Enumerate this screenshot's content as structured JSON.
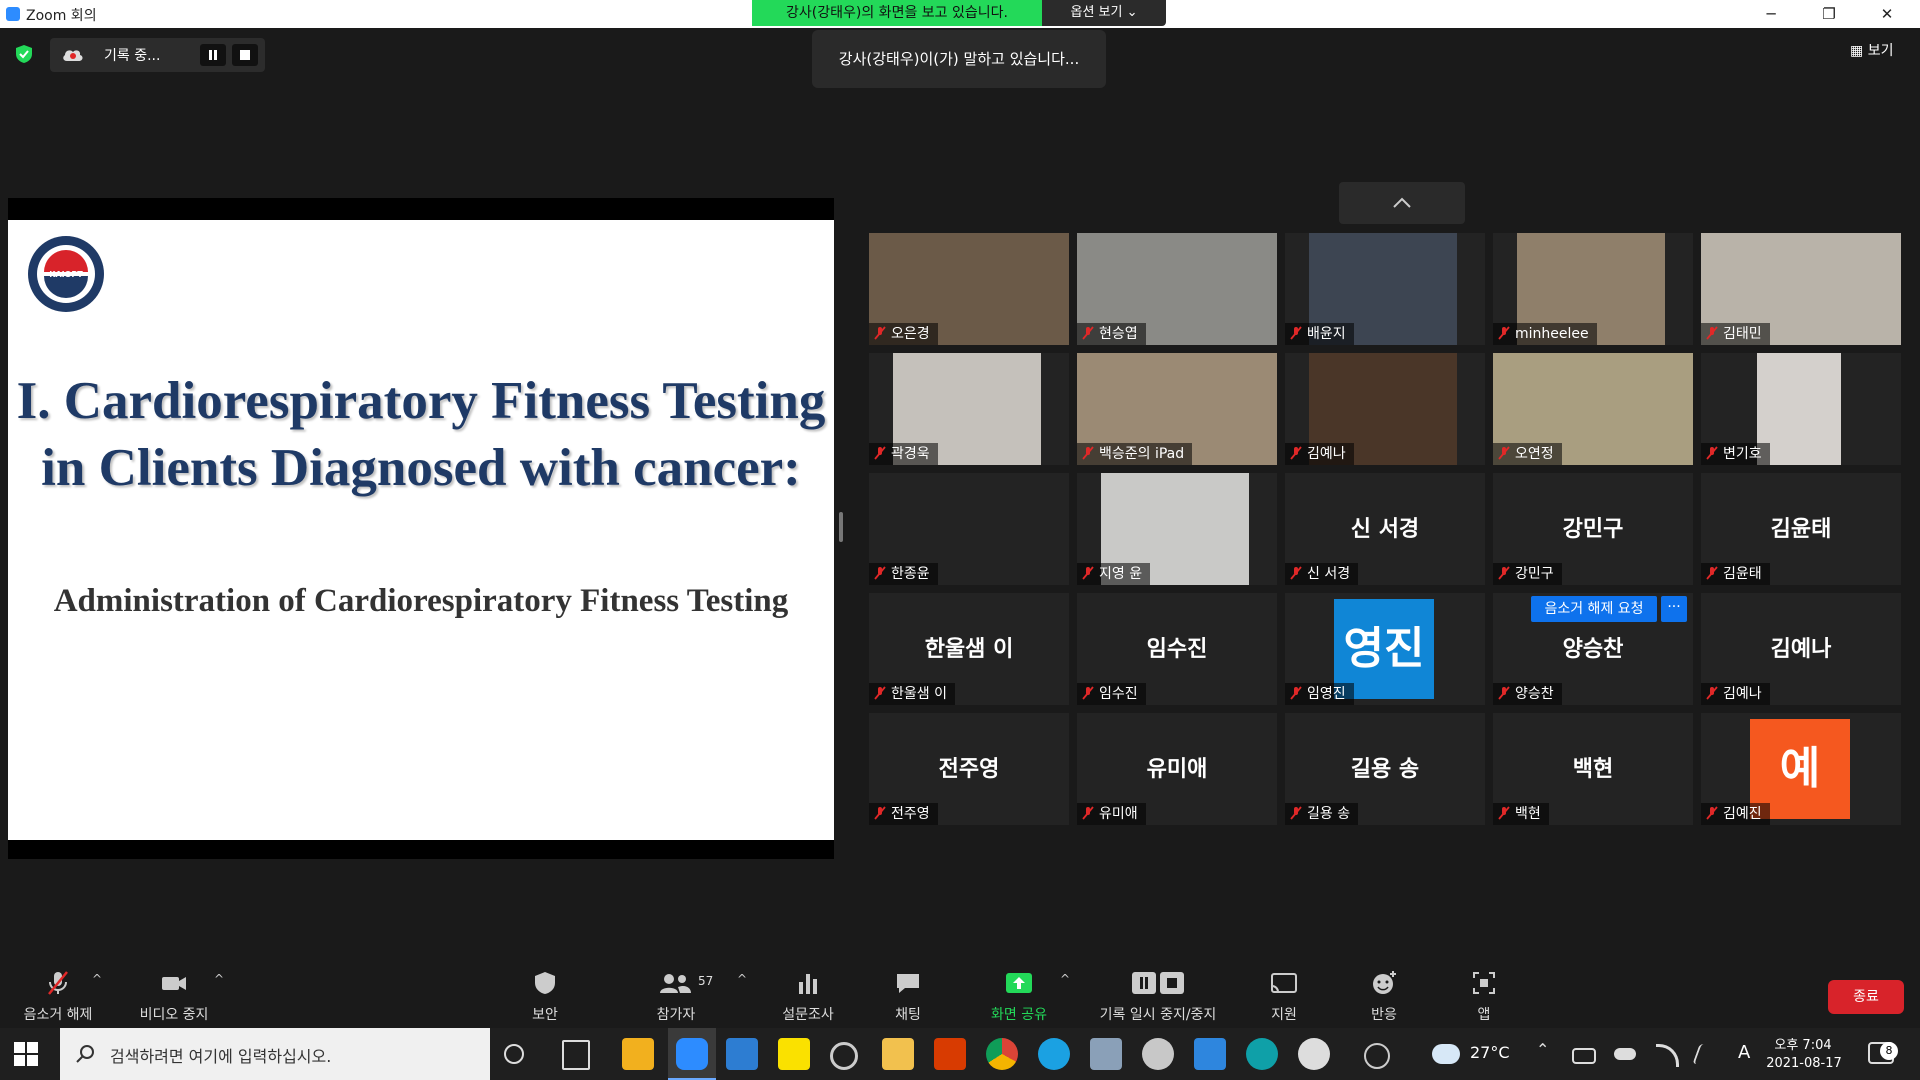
{
  "window": {
    "title": "Zoom 회의",
    "viewing_banner": "강사(강태우)의 화면을 보고 있습니다.",
    "view_options": "옵션 보기 ⌄",
    "minimize": "─",
    "restore": "❐",
    "close": "✕"
  },
  "top": {
    "recording_label": "기록 중...",
    "speaking_toast": "강사(강태우)이(가) 말하고 있습니다...",
    "view_button": "보기"
  },
  "slide": {
    "logo_text": "KAIOPT",
    "title": "I. Cardiorespiratory Fitness Testing in Clients Diagnosed with cancer:",
    "subtitle": "Administration of Cardiorespiratory Fitness Testing"
  },
  "gallery": {
    "tiles": [
      {
        "name": "오은경",
        "type": "video",
        "color": "#6b5a48"
      },
      {
        "name": "현승엽",
        "type": "video",
        "color": "#8a8a86"
      },
      {
        "name": "배윤지",
        "type": "video",
        "color": "#3d4552"
      },
      {
        "name": "minheelee",
        "type": "video",
        "color": "#8f7f6a"
      },
      {
        "name": "김태민",
        "type": "video",
        "color": "#b9b3a9"
      },
      {
        "name": "곽경욱",
        "type": "video",
        "color": "#c5c1bb"
      },
      {
        "name": "백승준의 iPad",
        "type": "video",
        "color": "#9b8a74"
      },
      {
        "name": "김예나",
        "type": "video",
        "color": "#4a3628"
      },
      {
        "name": "오연정",
        "type": "video",
        "color": "#a99e80"
      },
      {
        "name": "변기호",
        "type": "video",
        "color": "#d4d0cc"
      },
      {
        "name": "한종윤",
        "type": "blank"
      },
      {
        "name": "지영 윤",
        "type": "video",
        "color": "#c9c9c7"
      },
      {
        "name": "신 서경",
        "type": "name",
        "display": "신 서경"
      },
      {
        "name": "강민구",
        "type": "name",
        "display": "강민구"
      },
      {
        "name": "김윤태",
        "type": "name",
        "display": "김윤태"
      },
      {
        "name": "한울샘 이",
        "type": "name",
        "display": "한울샘 이"
      },
      {
        "name": "임수진",
        "type": "name",
        "display": "임수진"
      },
      {
        "name": "임영진",
        "type": "avatar",
        "display": "영진",
        "color": "#1086d6"
      },
      {
        "name": "양승찬",
        "type": "name",
        "display": "양승찬"
      },
      {
        "name": "김예나",
        "type": "name",
        "display": "김예나"
      },
      {
        "name": "전주영",
        "type": "name",
        "display": "전주영"
      },
      {
        "name": "유미애",
        "type": "name",
        "display": "유미애"
      },
      {
        "name": "길용 송",
        "type": "name",
        "display": "길용 송"
      },
      {
        "name": "백현",
        "type": "name",
        "display": "백현"
      },
      {
        "name": "김예진",
        "type": "avatar",
        "display": "예",
        "color": "#f5581f"
      }
    ],
    "unmute_request": "음소거 해제 요청",
    "more": "···"
  },
  "toolbar": {
    "unmute": "음소거 해제",
    "stop_video": "비디오 중지",
    "security": "보안",
    "participants": "참가자",
    "participant_count": "57",
    "polls": "설문조사",
    "chat": "채팅",
    "share_screen": "화면 공유",
    "pause_record": "기록 일시 중지/중지",
    "support": "지원",
    "reactions": "반응",
    "apps": "앱",
    "end": "종료",
    "caret": "^"
  },
  "taskbar": {
    "search_placeholder": "검색하려면 여기에 입력하십시오.",
    "temperature": "27°C",
    "time": "오후 7:04",
    "date": "2021-08-17",
    "notification_count": "8",
    "ime": "A"
  }
}
